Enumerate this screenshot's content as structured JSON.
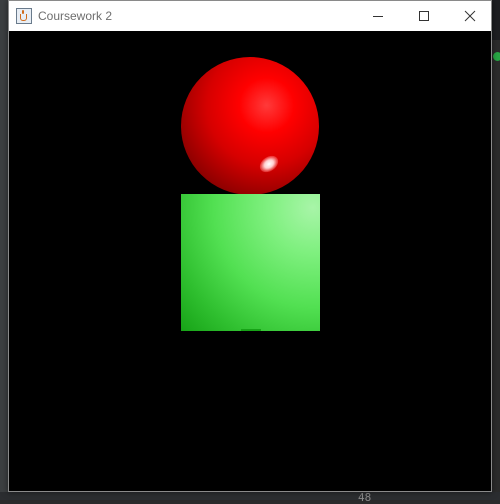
{
  "window": {
    "title": "Coursework 2",
    "controls": {
      "minimize": "minimize",
      "maximize": "maximize",
      "close": "close"
    }
  },
  "background_ide": {
    "line_number": "48"
  },
  "scene": {
    "sphere_color": "#ff0000",
    "cube_color": "#4ddf4d",
    "canvas_background": "#000000"
  }
}
